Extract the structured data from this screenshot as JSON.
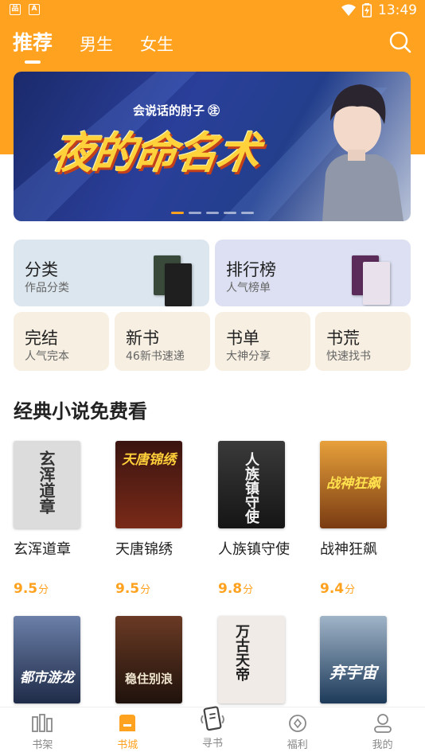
{
  "status": {
    "time": "13:49",
    "left_icons": [
      "qr-icon",
      "a-icon"
    ],
    "right_icons": [
      "wifi-icon",
      "battery-icon"
    ]
  },
  "nav": {
    "tabs": [
      {
        "label": "推荐",
        "active": true
      },
      {
        "label": "男生"
      },
      {
        "label": "女生"
      }
    ]
  },
  "banner": {
    "author": "会说话的肘子 ㊟",
    "title": "夜的命名术",
    "dots": 5,
    "active_dot": 0
  },
  "entries": {
    "big": [
      {
        "title": "分类",
        "subtitle": "作品分类"
      },
      {
        "title": "排行榜",
        "subtitle": "人气榜单"
      }
    ],
    "small": [
      {
        "title": "完结",
        "subtitle": "人气完本"
      },
      {
        "title": "新书",
        "subtitle": "46新书速递"
      },
      {
        "title": "书单",
        "subtitle": "大神分享"
      },
      {
        "title": "书荒",
        "subtitle": "快速找书"
      }
    ]
  },
  "section": {
    "title": "经典小说免费看"
  },
  "books": [
    {
      "name": "玄浑道章",
      "score": "9.5",
      "unit": "分",
      "cover_text": "玄浑道章",
      "cover_color": "#dcdcdc",
      "text_color": "#333333"
    },
    {
      "name": "天唐锦绣",
      "score": "9.5",
      "unit": "分",
      "cover_text": "天唐锦绣",
      "cover_color": "#5a1a12",
      "text_color": "#ffcf3a"
    },
    {
      "name": "人族镇守使",
      "score": "9.8",
      "unit": "分",
      "cover_text": "人族镇守使",
      "cover_color": "#2b2b2b",
      "text_color": "#f2f2f2"
    },
    {
      "name": "战神狂飙",
      "score": "9.4",
      "unit": "分",
      "cover_text": "战神狂飙",
      "cover_color": "#b3541d",
      "text_color": "#ffe14d"
    },
    {
      "name": "",
      "score": "",
      "unit": "",
      "cover_text": "都市游龙",
      "cover_color": "#2a3e67",
      "text_color": "#ffffff"
    },
    {
      "name": "",
      "score": "",
      "unit": "",
      "cover_text": "稳住别浪",
      "cover_color": "#3d2418",
      "text_color": "#f0e6cf"
    },
    {
      "name": "",
      "score": "",
      "unit": "",
      "cover_text": "万古天帝",
      "cover_color": "#efe7e3",
      "text_color": "#222222"
    },
    {
      "name": "",
      "score": "",
      "unit": "",
      "cover_text": "弃宇宙",
      "cover_color": "#1d3a5a",
      "text_color": "#ffffff"
    }
  ],
  "bottom_nav": [
    {
      "label": "书架",
      "icon": "bookshelf-icon"
    },
    {
      "label": "书城",
      "icon": "bookstore-icon",
      "active": true
    },
    {
      "label": "寻书",
      "icon": "find-book-icon"
    },
    {
      "label": "福利",
      "icon": "welfare-icon"
    },
    {
      "label": "我的",
      "icon": "profile-icon"
    }
  ],
  "colors": {
    "accent": "#ffa220"
  }
}
